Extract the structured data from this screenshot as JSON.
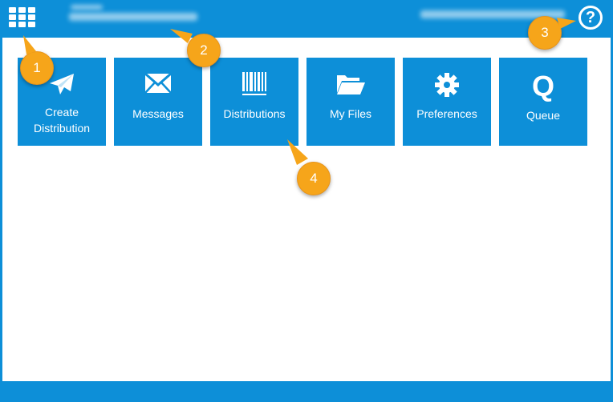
{
  "header": {
    "help_icon_text": "?"
  },
  "tiles": [
    {
      "label": "Create Distribution",
      "icon": "paper-plane-icon"
    },
    {
      "label": "Messages",
      "icon": "envelope-icon"
    },
    {
      "label": "Distributions",
      "icon": "barcode-icon"
    },
    {
      "label": "My Files",
      "icon": "folder-open-icon"
    },
    {
      "label": "Preferences",
      "icon": "gear-icon"
    },
    {
      "label": "Queue",
      "icon": "q-icon",
      "icon_text": "Q"
    }
  ],
  "callouts": [
    "1",
    "2",
    "3",
    "4"
  ],
  "colors": {
    "brand_blue": "#0d8fd8",
    "callout_orange": "#f6a51a",
    "surface": "#ffffff"
  }
}
